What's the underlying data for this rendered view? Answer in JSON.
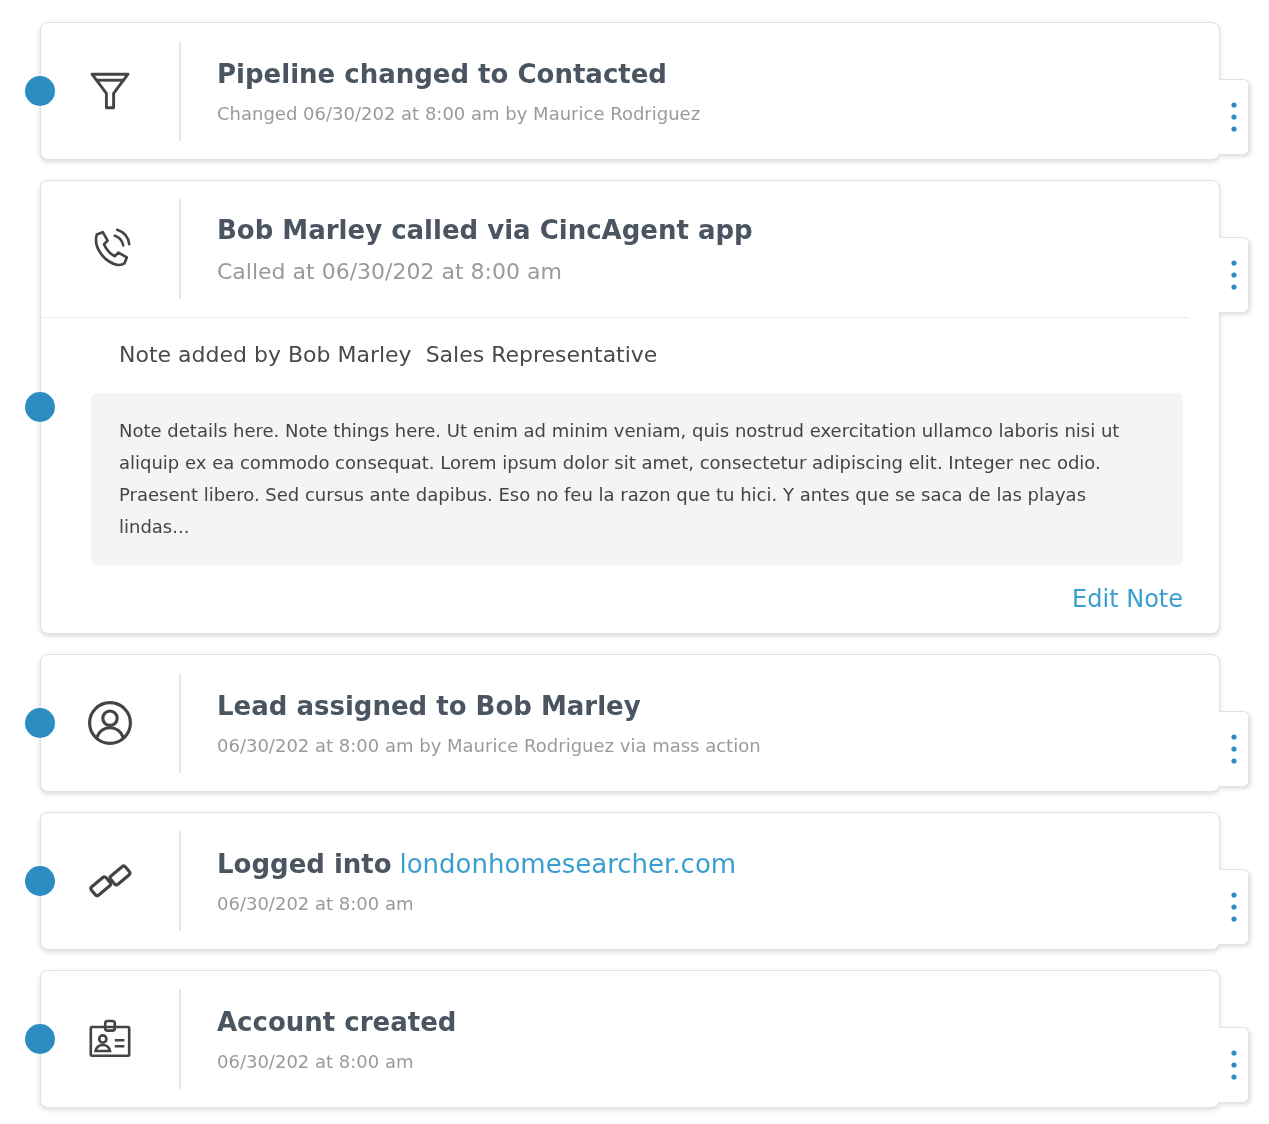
{
  "timeline": [
    {
      "kind": "funnel",
      "title": "Pipeline changed to Contacted",
      "subtitle": "Changed 06/30/202 at 8:00 am by Maurice Rodriguez"
    },
    {
      "kind": "phone",
      "title": "Bob Marley called via CincAgent app",
      "subtitle": "Called at 06/30/202 at 8:00 am",
      "note": {
        "heading": "Note added by Bob Marley  Sales Representative",
        "body": "Note details here. Note things here. Ut enim ad minim veniam, quis nostrud exercitation ullamco laboris nisi ut aliquip ex ea commodo consequat. Lorem ipsum dolor sit amet, consectetur adipiscing elit. Integer nec odio. Praesent libero. Sed cursus ante dapibus. Eso no feu la razon que tu hici. Y antes que se saca de las playas lindas...",
        "edit_label": "Edit Note"
      }
    },
    {
      "kind": "person",
      "title": "Lead assigned to Bob Marley",
      "subtitle": "06/30/202 at 8:00 am by Maurice Rodriguez via mass action"
    },
    {
      "kind": "link",
      "title": "Logged into",
      "link": "londonhomesearcher.com",
      "subtitle": "06/30/202 at 8:00 am"
    },
    {
      "kind": "badge",
      "title": "Account created",
      "subtitle": "06/30/202 at 8:00 am"
    }
  ]
}
